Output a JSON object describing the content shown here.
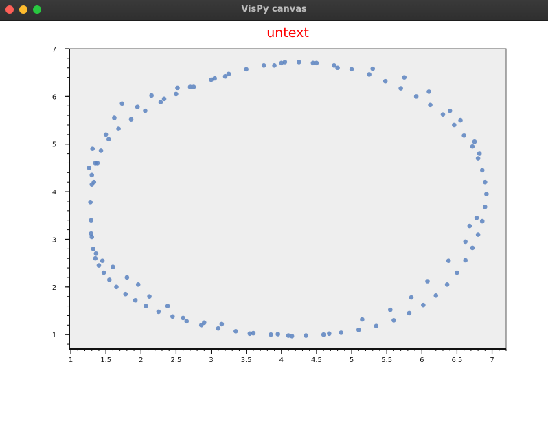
{
  "window": {
    "title": "VisPy canvas"
  },
  "chart_data": {
    "type": "scatter",
    "title": "untext",
    "title_color": "#ff0000",
    "xlabel": "",
    "ylabel": "",
    "xlim": [
      0.98,
      7.2
    ],
    "ylim": [
      0.7,
      7.0
    ],
    "xticks": [
      "1",
      "1.5",
      "2",
      "2.5",
      "3",
      "3.5",
      "4",
      "4.5",
      "5",
      "5.5",
      "6",
      "6.5",
      "7"
    ],
    "yticks": [
      "1",
      "2",
      "3",
      "4",
      "5",
      "6",
      "7"
    ],
    "plot_background": "#eeeeee",
    "marker_color": "#5a82c0",
    "grid": false,
    "legend": "none",
    "x": [
      1.3,
      1.28,
      1.29,
      1.3,
      1.32,
      1.35,
      1.4,
      1.47,
      1.55,
      1.65,
      1.78,
      1.92,
      2.07,
      2.25,
      2.45,
      2.65,
      2.86,
      3.1,
      3.35,
      3.6,
      3.85,
      4.1,
      4.35,
      4.6,
      4.85,
      5.1,
      5.35,
      5.6,
      5.82,
      6.02,
      6.2,
      6.36,
      6.5,
      6.62,
      6.72,
      6.8,
      6.86,
      6.9,
      6.92,
      6.9,
      6.86,
      6.8,
      6.72,
      6.6,
      6.46,
      6.3,
      6.12,
      5.92,
      5.7,
      5.48,
      5.25,
      5.0,
      4.75,
      4.5,
      4.25,
      4.0,
      3.75,
      3.5,
      3.25,
      3.0,
      2.75,
      2.5,
      2.28,
      2.06,
      1.86,
      1.68,
      1.54,
      1.43,
      1.35,
      1.3,
      1.26,
      1.31,
      1.33,
      1.38,
      1.5,
      1.62,
      1.73,
      1.95,
      2.15,
      2.33,
      2.52,
      2.7,
      3.05,
      3.2,
      3.9,
      4.05,
      4.45,
      4.8,
      5.3,
      5.75,
      6.1,
      6.4,
      6.55,
      6.75,
      6.82,
      6.78,
      6.68,
      6.62,
      6.38,
      6.08,
      5.85,
      5.55,
      5.15,
      4.68,
      4.15,
      3.95,
      3.55,
      3.15,
      2.9,
      2.6,
      2.38,
      2.12,
      1.96,
      1.8,
      1.6,
      1.45,
      1.36,
      1.29
    ],
    "y": [
      4.15,
      3.78,
      3.4,
      3.05,
      2.8,
      2.6,
      2.45,
      2.3,
      2.15,
      2.0,
      1.85,
      1.72,
      1.6,
      1.48,
      1.38,
      1.28,
      1.2,
      1.13,
      1.07,
      1.03,
      1.0,
      0.98,
      0.98,
      1.0,
      1.04,
      1.1,
      1.18,
      1.3,
      1.45,
      1.62,
      1.82,
      2.05,
      2.3,
      2.56,
      2.82,
      3.1,
      3.38,
      3.68,
      3.95,
      4.2,
      4.45,
      4.7,
      4.95,
      5.18,
      5.4,
      5.62,
      5.82,
      6.0,
      6.17,
      6.32,
      6.46,
      6.57,
      6.65,
      6.7,
      6.72,
      6.7,
      6.65,
      6.57,
      6.47,
      6.35,
      6.2,
      6.05,
      5.88,
      5.7,
      5.52,
      5.32,
      5.1,
      4.86,
      4.6,
      4.35,
      4.5,
      4.9,
      4.2,
      4.6,
      5.2,
      5.55,
      5.85,
      5.78,
      6.02,
      5.95,
      6.18,
      6.2,
      6.38,
      6.42,
      6.65,
      6.72,
      6.7,
      6.6,
      6.58,
      6.4,
      6.1,
      5.7,
      5.5,
      5.05,
      4.8,
      3.45,
      3.28,
      2.95,
      2.55,
      2.12,
      1.78,
      1.52,
      1.32,
      1.02,
      0.97,
      1.01,
      1.02,
      1.22,
      1.25,
      1.35,
      1.6,
      1.8,
      2.05,
      2.2,
      2.42,
      2.55,
      2.7,
      3.12
    ]
  }
}
